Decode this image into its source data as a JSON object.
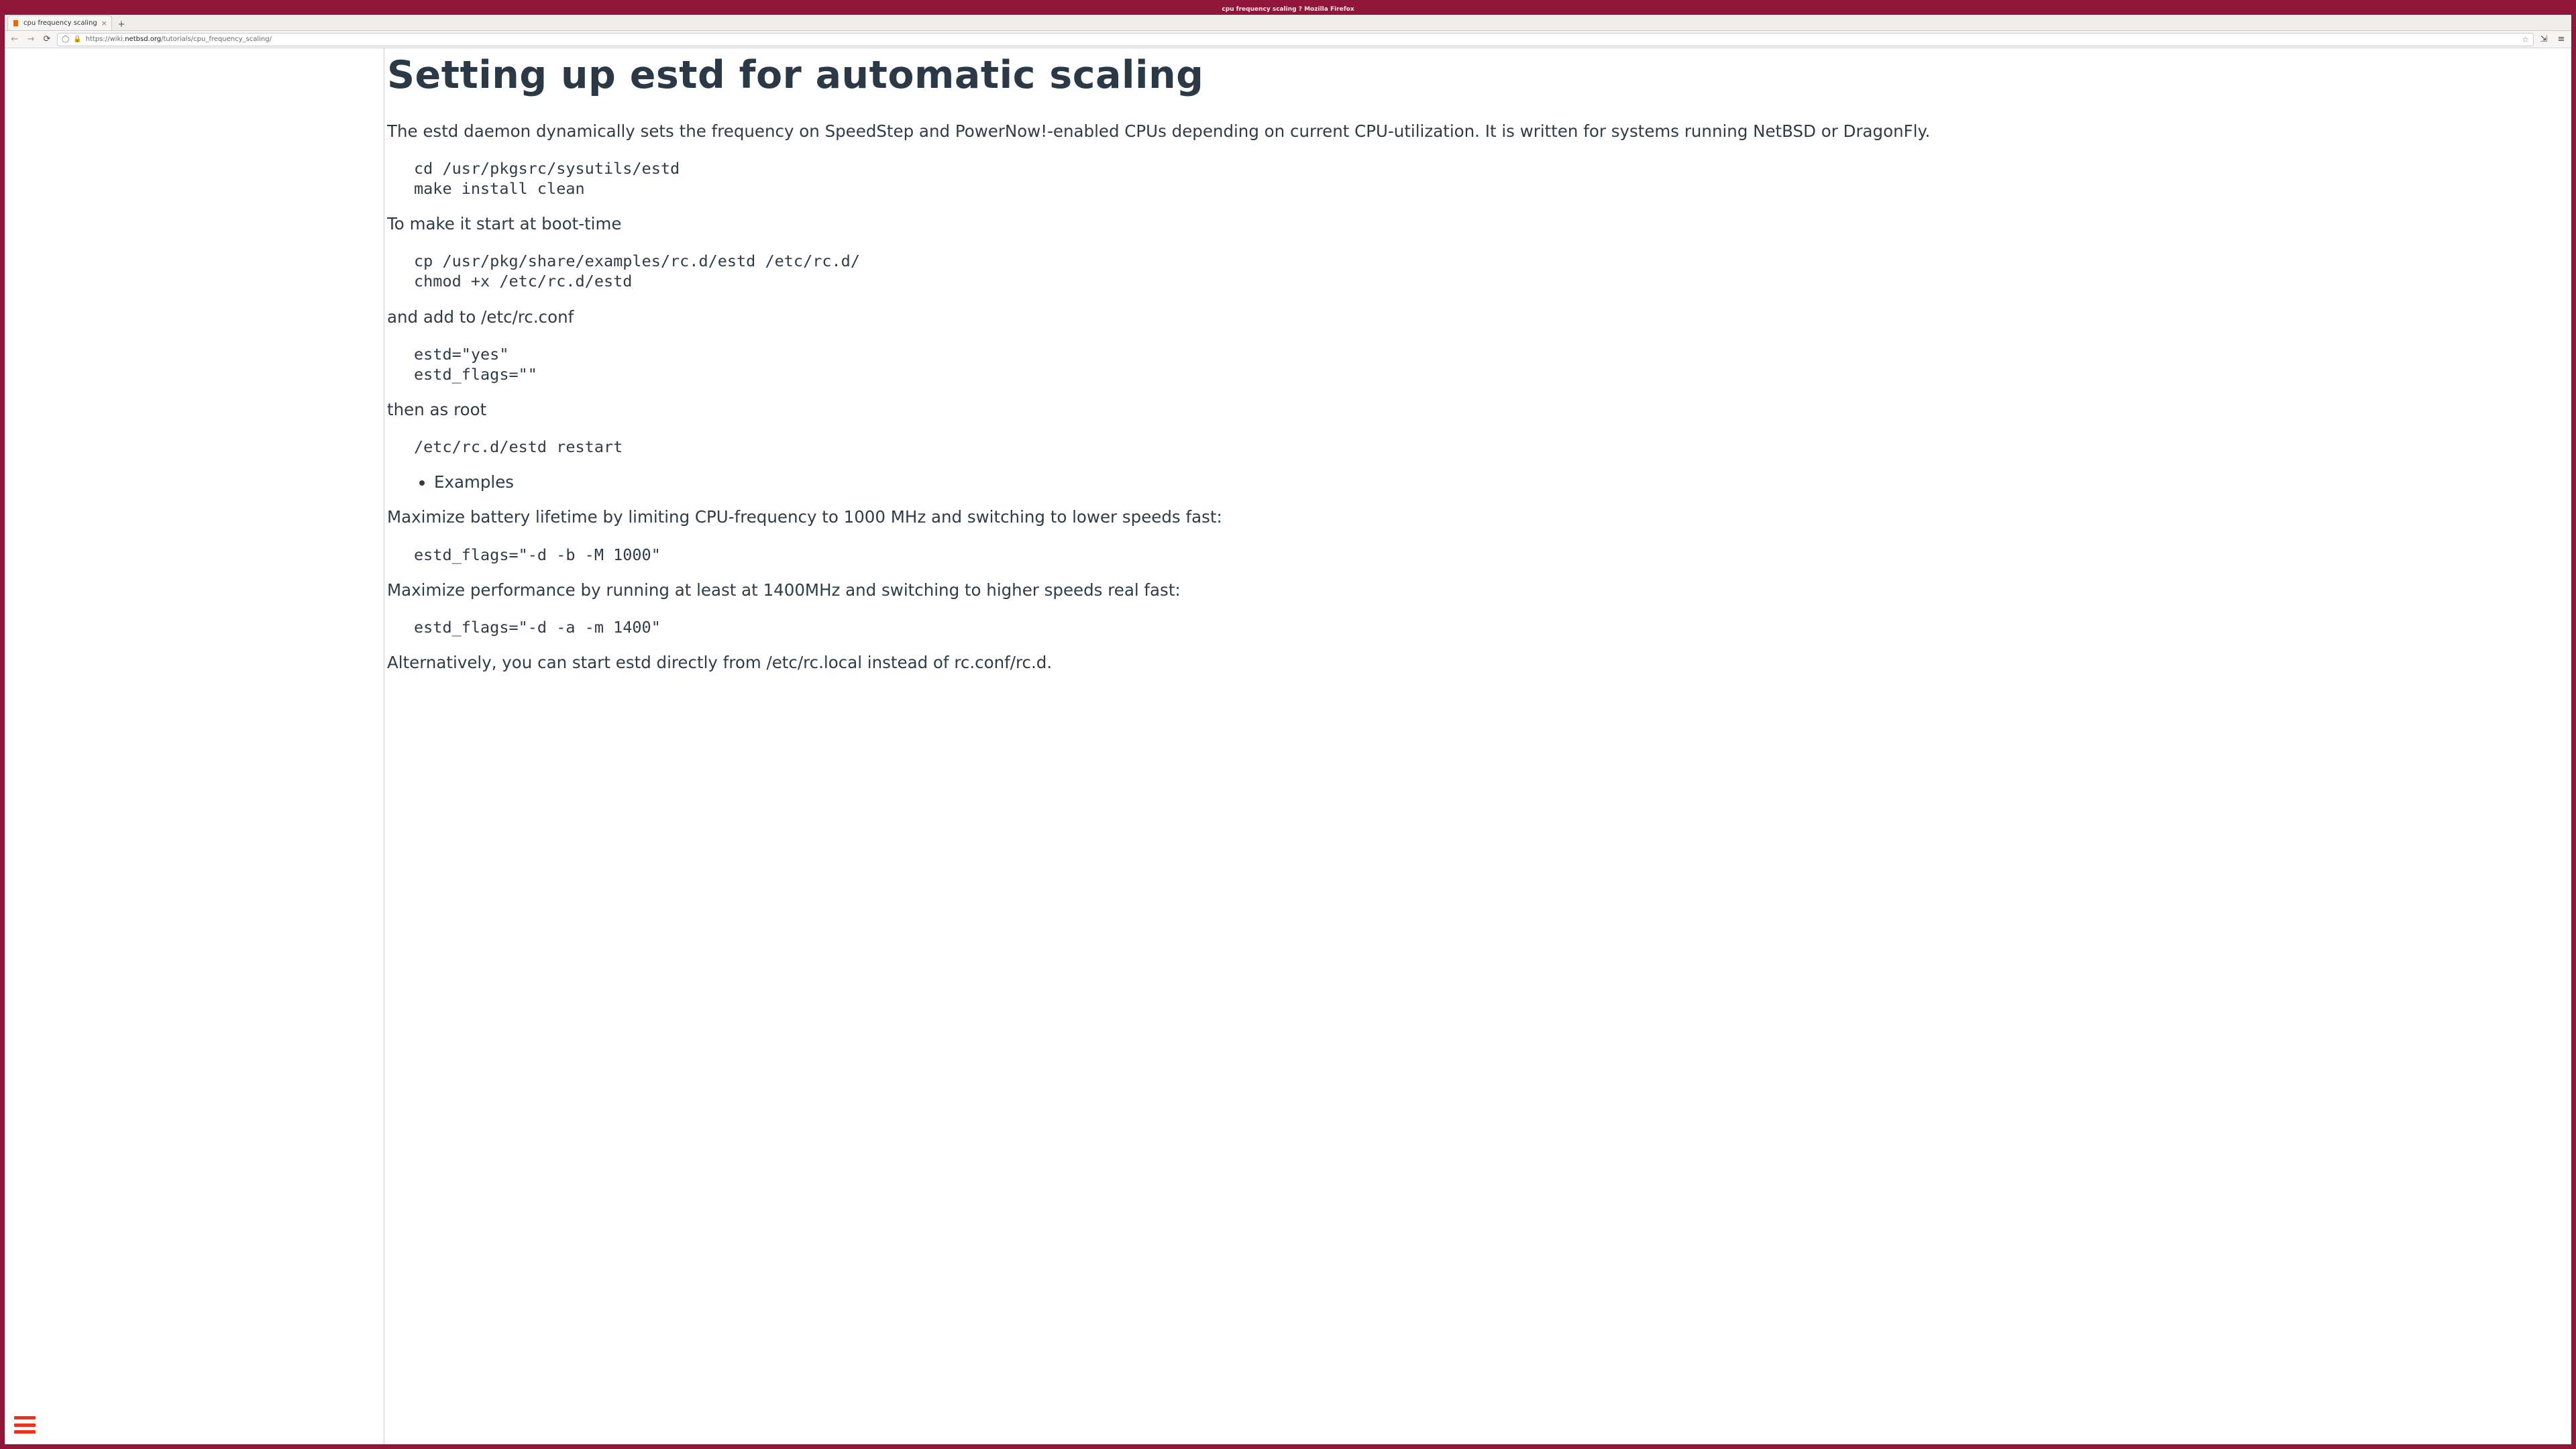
{
  "window": {
    "title": "cpu frequency scaling ? Mozilla Firefox"
  },
  "browser": {
    "tab_label": "cpu frequency scaling",
    "url_prefix": "https://wiki.",
    "url_domain": "netbsd.org",
    "url_path": "/tutorials/cpu_frequency_scaling/"
  },
  "article": {
    "heading": "Setting up estd for automatic scaling",
    "p1": "The estd daemon dynamically sets the frequency on SpeedStep and PowerNow!-enabled CPUs depending on current CPU-utilization. It is written for systems running NetBSD or DragonFly.",
    "code1": "cd /usr/pkgsrc/sysutils/estd\nmake install clean",
    "p2": "To make it start at boot-time",
    "code2": "cp /usr/pkg/share/examples/rc.d/estd /etc/rc.d/\nchmod +x /etc/rc.d/estd",
    "p3": "and add to /etc/rc.conf",
    "code3": "estd=\"yes\"\nestd_flags=\"\"",
    "p4": "then as root",
    "code4": "/etc/rc.d/estd restart",
    "bullet1": "Examples",
    "p5": "Maximize battery lifetime by limiting CPU-frequency to 1000 MHz and switching to lower speeds fast:",
    "code5": "estd_flags=\"-d -b -M 1000\"",
    "p6": "Maximize performance by running at least at 1400MHz and switching to higher speeds real fast:",
    "code6": "estd_flags=\"-d -a -m 1400\"",
    "p7": "Alternatively, you can start estd directly from /etc/rc.local instead of rc.conf/rc.d."
  }
}
